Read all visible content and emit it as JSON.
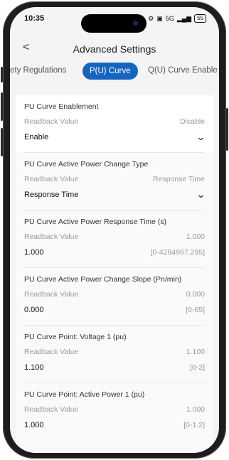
{
  "status": {
    "time": "10:35",
    "signal": "5G",
    "battery": "55"
  },
  "nav": {
    "title": "Advanced Settings"
  },
  "tabs": [
    {
      "label": "ety Regulations"
    },
    {
      "label": "P(U) Curve"
    },
    {
      "label": "Q(U) Curve Enable"
    }
  ],
  "settings": [
    {
      "title": "PU Curve Enablement",
      "readback_label": "Readback Value",
      "readback": "Disable",
      "value": "Enable"
    },
    {
      "title": "PU Curve Active Power Change Type",
      "readback_label": "Readback Value",
      "readback": "Response Time",
      "value": "Response Time"
    },
    {
      "title": "PU Curve Active Power Response Time (s)",
      "readback_label": "Readback Value",
      "readback": "1.000",
      "value": "1.000",
      "range": "[0-4294967.295]"
    },
    {
      "title": "PU Curve Active Power Change Slope (Pn/min)",
      "readback_label": "Readback Value",
      "readback": "0.000",
      "value": "0.000",
      "range": "[0-65]"
    },
    {
      "title": "PU Curve Point: Voltage 1 (pu)",
      "readback_label": "Readback Value",
      "readback": "1.100",
      "value": "1.100",
      "range": "[0-2]"
    },
    {
      "title": "PU Curve Point: Active Power 1 (pu)",
      "readback_label": "Readback Value",
      "readback": "1.000",
      "value": "1.000",
      "range": "[0-1.2]"
    }
  ]
}
